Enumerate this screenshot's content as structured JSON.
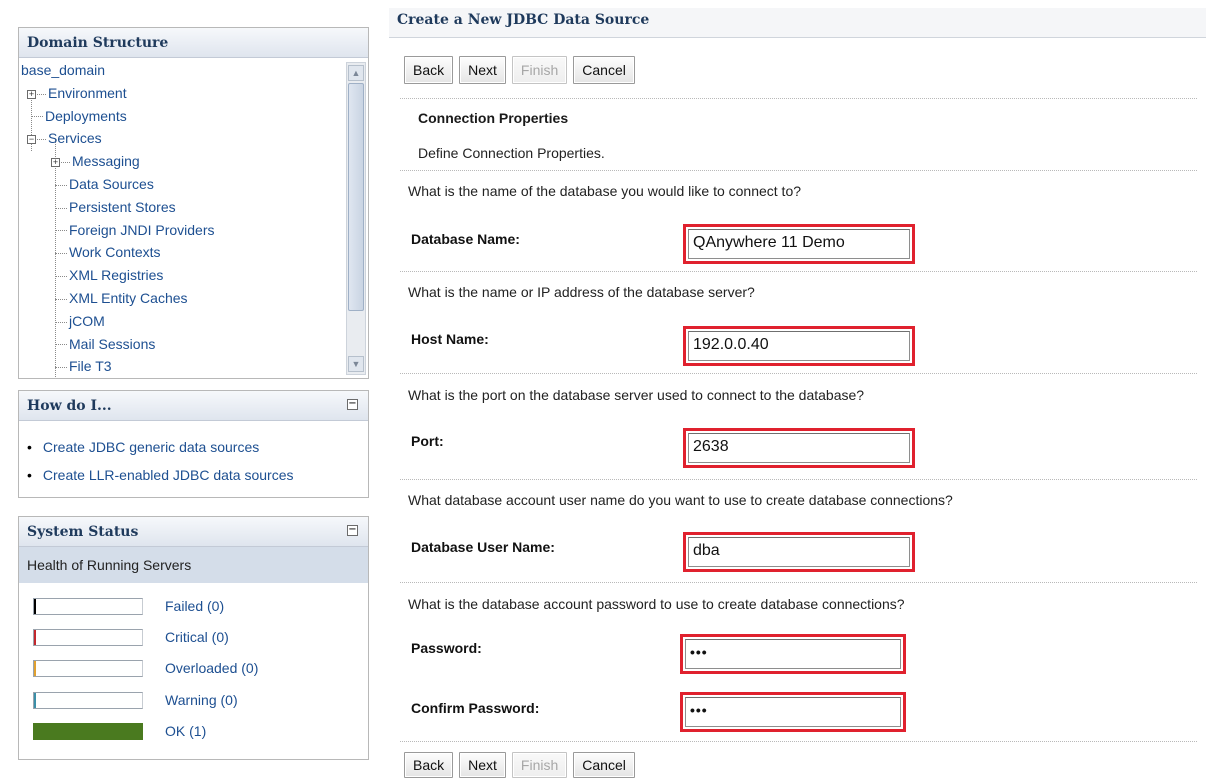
{
  "domain_structure": {
    "title": "Domain Structure",
    "items": [
      {
        "label": "base_domain"
      },
      {
        "label": "Environment"
      },
      {
        "label": "Deployments"
      },
      {
        "label": "Services"
      },
      {
        "label": "Messaging"
      },
      {
        "label": "Data Sources"
      },
      {
        "label": "Persistent Stores"
      },
      {
        "label": "Foreign JNDI Providers"
      },
      {
        "label": "Work Contexts"
      },
      {
        "label": "XML Registries"
      },
      {
        "label": "XML Entity Caches"
      },
      {
        "label": "jCOM"
      },
      {
        "label": "Mail Sessions"
      },
      {
        "label": "File T3"
      }
    ]
  },
  "how_do_i": {
    "title": "How do I...",
    "links": [
      "Create JDBC generic data sources",
      "Create LLR-enabled JDBC data sources"
    ]
  },
  "system_status": {
    "title": "System Status",
    "subtitle": "Health of Running Servers",
    "rows": [
      {
        "label": "Failed (0)",
        "value": 0,
        "color": "#000000"
      },
      {
        "label": "Critical (0)",
        "value": 0,
        "color": "#c2272d"
      },
      {
        "label": "Overloaded (0)",
        "value": 0,
        "color": "#e0a030"
      },
      {
        "label": "Warning (0)",
        "value": 0,
        "color": "#3b8fa8"
      },
      {
        "label": "OK (1)",
        "value": 1,
        "color": "#4a7a1f"
      }
    ]
  },
  "page": {
    "title": "Create a New JDBC Data Source",
    "buttons": {
      "back": "Back",
      "next": "Next",
      "finish": "Finish",
      "cancel": "Cancel"
    },
    "section_title": "Connection Properties",
    "section_desc": "Define Connection Properties.",
    "fields": {
      "db_name": {
        "question": "What is the name of the database you would like to connect to?",
        "label": "Database Name:",
        "value": "QAnywhere 11 Demo"
      },
      "host": {
        "question": "What is the name or IP address of the database server?",
        "label": "Host Name:",
        "value": "192.0.0.40"
      },
      "port": {
        "question": "What is the port on the database server used to connect to the database?",
        "label": "Port:",
        "value": "2638"
      },
      "user": {
        "question": "What database account user name do you want to use to create database connections?",
        "label": "Database User Name:",
        "value": "dba"
      },
      "password": {
        "question": "What is the database account password to use to create database connections?",
        "label": "Password:",
        "value": "•••"
      },
      "confirm": {
        "label": "Confirm Password:",
        "value": "•••"
      }
    }
  }
}
